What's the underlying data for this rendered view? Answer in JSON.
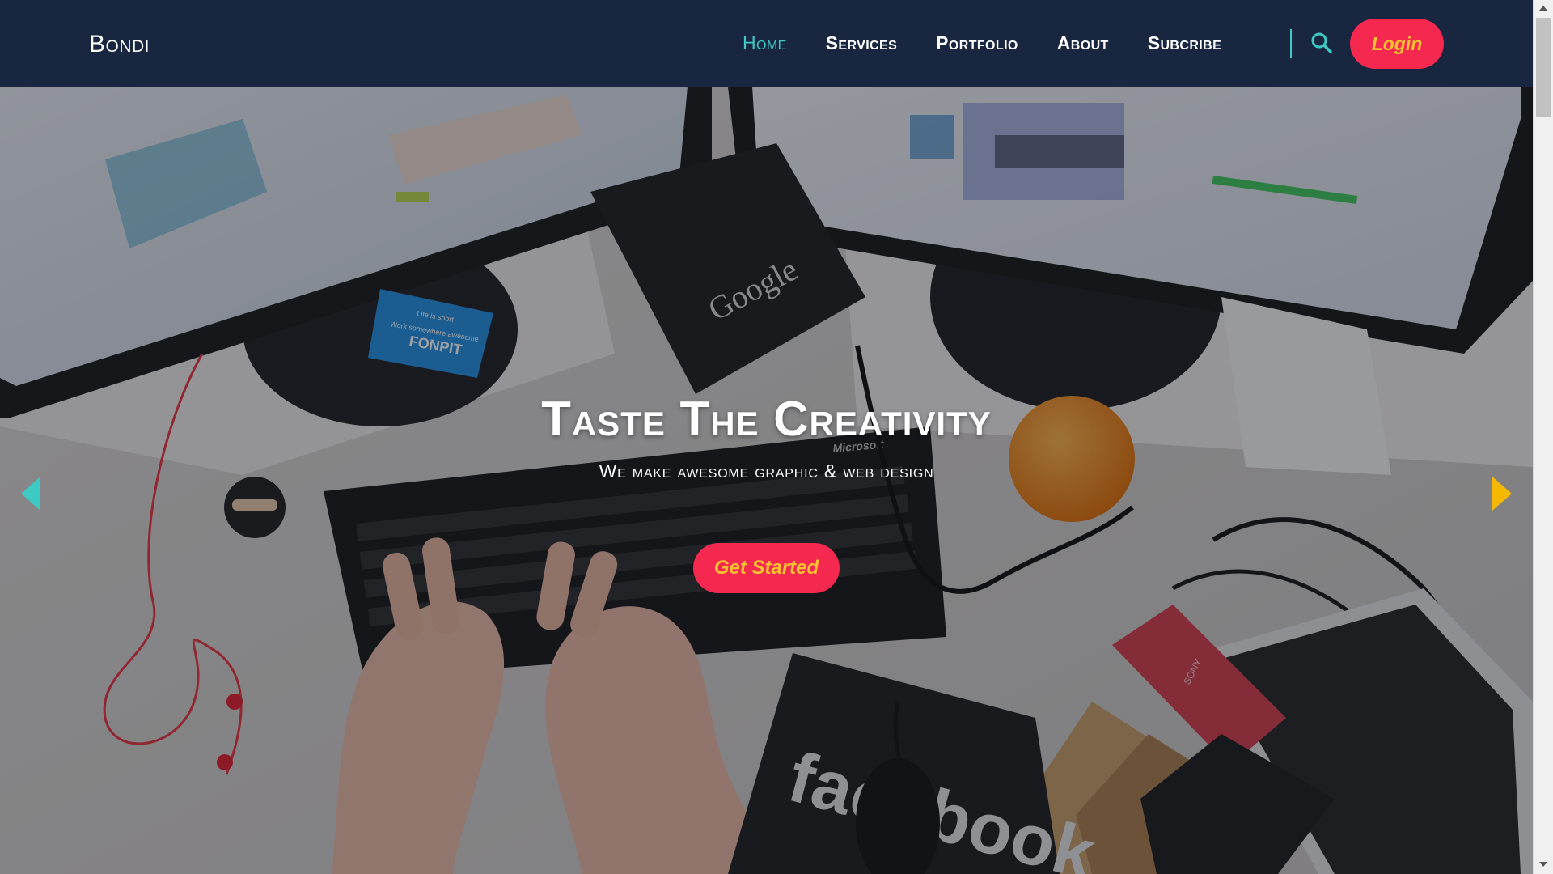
{
  "navbar": {
    "brand": "Bondi",
    "links": [
      {
        "label": "Home",
        "active": true
      },
      {
        "label": "Services",
        "active": false
      },
      {
        "label": "Portfolio",
        "active": false
      },
      {
        "label": "About",
        "active": false
      },
      {
        "label": "Subcribe",
        "active": false
      }
    ],
    "search_icon": "search-icon",
    "login_label": "Login"
  },
  "hero": {
    "title": "Taste The Creativity",
    "subtitle": "We make awesome graphic & web design",
    "cta_label": "Get Started",
    "prev_icon": "caret-left-icon",
    "next_icon": "caret-right-icon",
    "background": "photo of a desk with two monitors, keyboard, hands typing, orange, phones, mouse",
    "photo_text": {
      "book_logo": "Google",
      "card_brand": "FONPIT",
      "card_line1": "Life is short",
      "card_line2": "Work somewhere awesome",
      "keyboard_brand": "Microsoft",
      "notebook_logo": "facebook",
      "phone_brand": "SONY"
    }
  },
  "colors": {
    "navbar_bg": "#182640",
    "accent_teal": "#3dc9c4",
    "button_bg": "#f5294f",
    "button_text": "#f9c233",
    "next_arrow": "#f5b700"
  }
}
